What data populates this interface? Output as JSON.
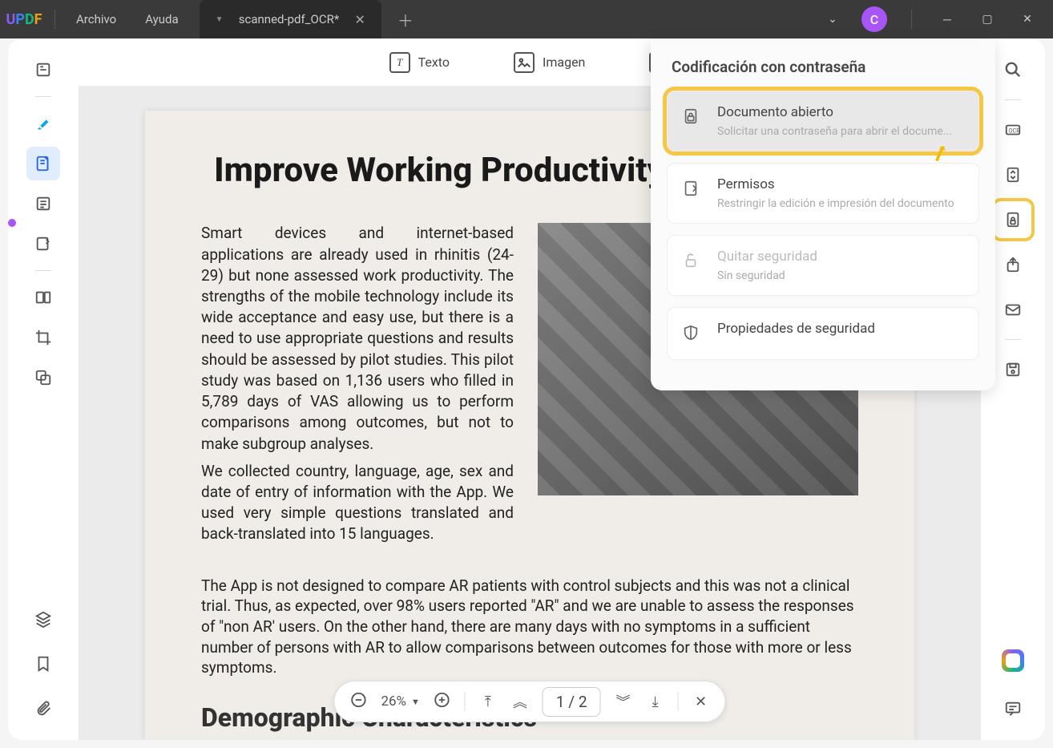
{
  "titlebar": {
    "logo": "UPDF",
    "menu_archivo": "Archivo",
    "menu_ayuda": "Ayuda",
    "tab_title": "scanned-pdf_OCR*",
    "avatar_letter": "C"
  },
  "toolbar": {
    "texto": "Texto",
    "imagen": "Imagen"
  },
  "popup": {
    "title": "Codificación con contraseña",
    "open_doc_title": "Documento abierto",
    "open_doc_sub": "Solicitar una contraseña para abrir el docume...",
    "perms_title": "Permisos",
    "perms_sub": "Restringir la edición e impresión del documento",
    "remove_title": "Quitar seguridad",
    "remove_sub": "Sin seguridad",
    "props_title": "Propiedades de seguridad"
  },
  "document": {
    "heading": "Improve Working Productivity Using Apps",
    "para1a": "Smart devices and internet-based applications are already used in rhinitis (24-29) but none assessed work productivity. The strengths of the mobile technology include its wide acceptance and easy use, but there is a need to use appropriate questions and results should be assessed by pilot studies. This pilot study was based on 1,136 users who filled in 5,789 days of VAS allowing us to perform comparisons among outcomes, but not to make subgroup analyses.",
    "para1b": "We collected country, language, age, sex and date of entry of information with the App. We used very simple questions translated and back-translated into 15 languages.",
    "para2": "The App is not designed to compare AR patients with control subjects and this was not a clinical trial. Thus, as expected, over 98% users reported \"AR\" and we are unable to assess the responses of \"non AR' users. On the other hand, there are many days with no symptoms in a sufficient number of persons with AR to allow comparisons between outcomes for those with more or less symptoms.",
    "heading2": "Demographic Characteristics"
  },
  "bottombar": {
    "zoom": "26%",
    "page_current": "1",
    "page_sep": "/",
    "page_total": "2"
  }
}
